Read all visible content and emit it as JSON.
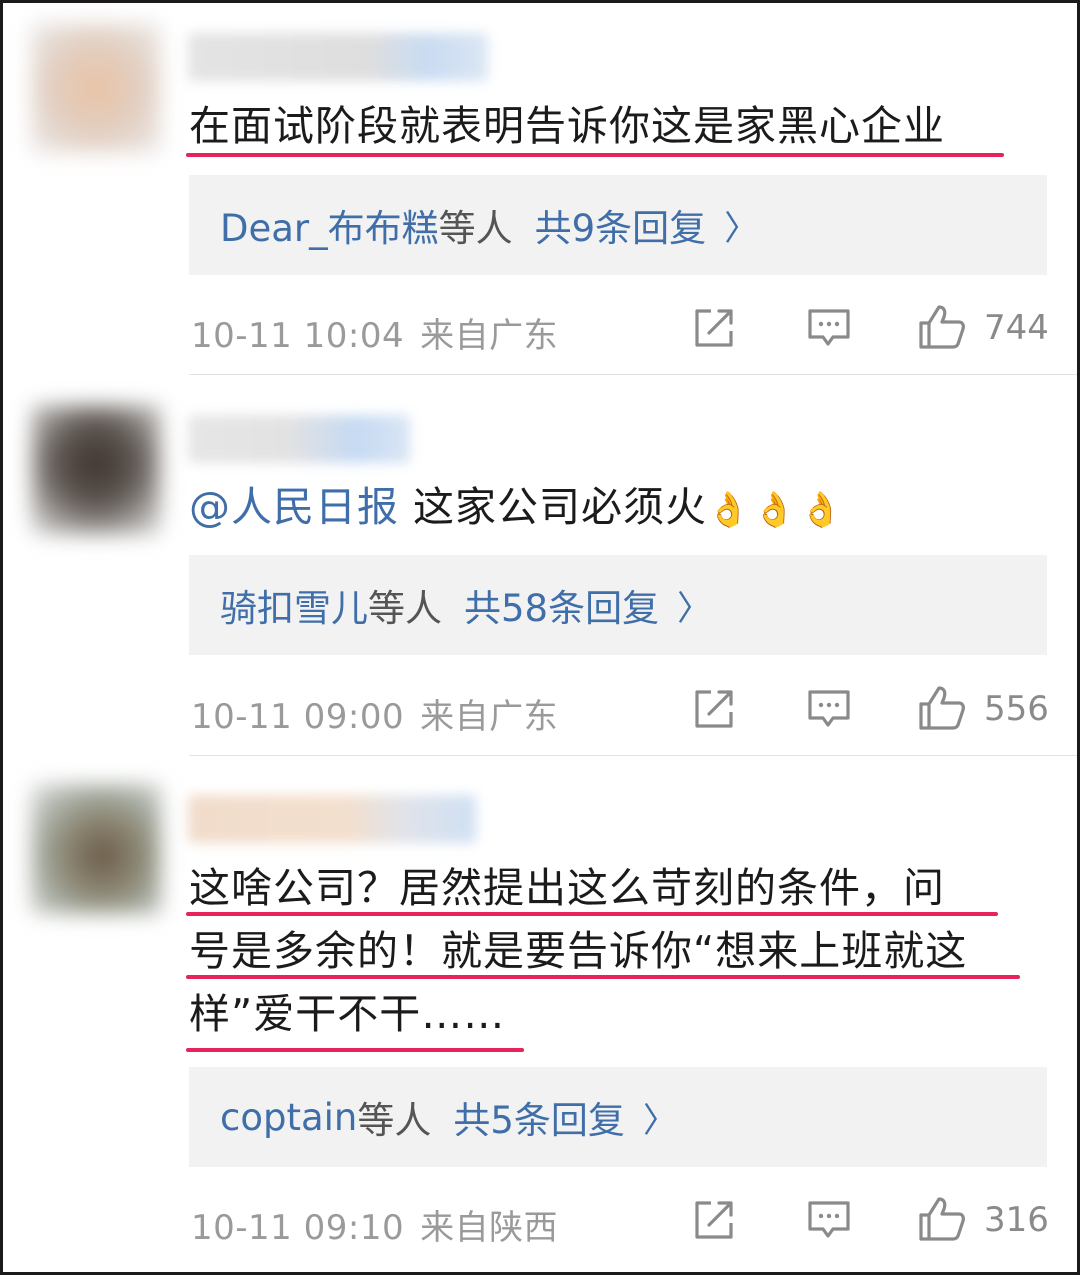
{
  "comments": [
    {
      "lines": [
        "在面试阶段就表明告诉你这是家黑心企业"
      ],
      "reply_users": "Dear_布布糕",
      "reply_others": "等人",
      "reply_count": "共9条回复",
      "time": "10-11 10:04",
      "location": "来自广东",
      "likes": "744"
    },
    {
      "mention": "@人民日报",
      "body": "这家公司必须火",
      "emoji": "👌👌👌",
      "reply_users": "骑扣雪儿",
      "reply_others": "等人",
      "reply_count": "共58条回复",
      "time": "10-11 09:00",
      "location": "来自广东",
      "likes": "556"
    },
    {
      "lines": [
        "这啥公司？居然提出这么苛刻的条件，问",
        "号是多余的！就是要告诉你“想来上班就这",
        "样”爱干不干……"
      ],
      "reply_users": "coptain",
      "reply_others": "等人",
      "reply_count": "共5条回复",
      "time": "10-11 09:10",
      "location": "来自陕西",
      "likes": "316"
    }
  ],
  "icons": {
    "share": "share-icon",
    "comment": "comment-icon",
    "like": "like-icon",
    "chevron": "chevron-right-icon"
  },
  "colors": {
    "accent": "#3f6ea8",
    "highlight": "#e6245b",
    "reply_bg": "#f2f2f2"
  },
  "chevron_glyph": "〉"
}
